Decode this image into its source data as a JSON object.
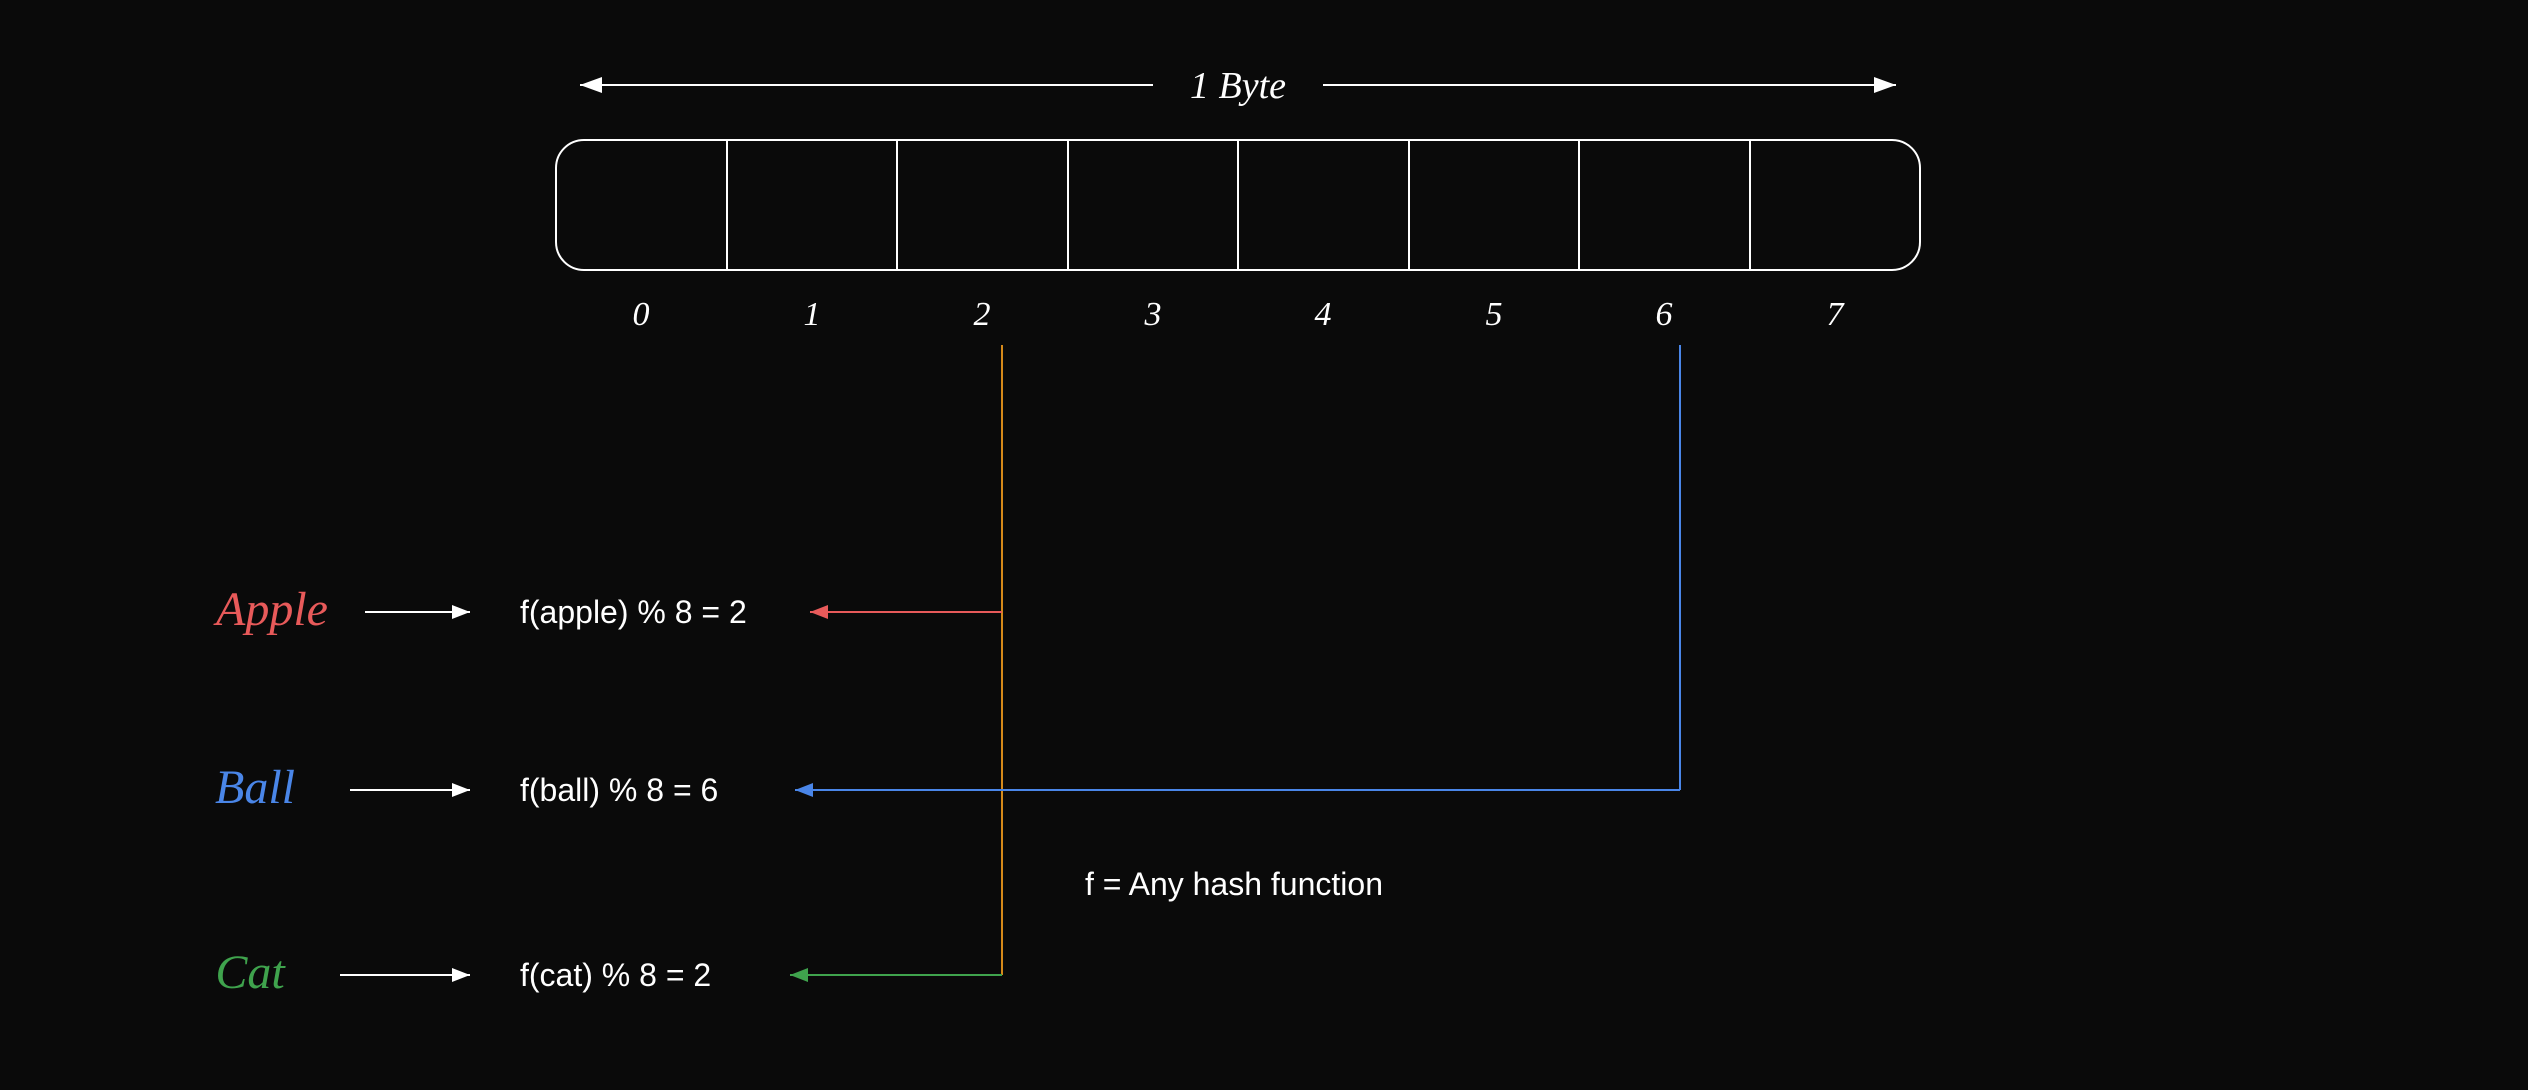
{
  "byte_label": "1 Byte",
  "indices": [
    "0",
    "1",
    "2",
    "3",
    "4",
    "5",
    "6",
    "7"
  ],
  "items": [
    {
      "name": "Apple",
      "expr": "f(apple) % 8 = 2",
      "color": "#e85a5a"
    },
    {
      "name": "Ball",
      "expr": "f(ball) % 8 = 6",
      "color": "#4a86e8"
    },
    {
      "name": "Cat",
      "expr": "f(cat) % 8 = 2",
      "color": "#3fa34d"
    }
  ],
  "note": "f = Any hash function",
  "colors": {
    "stroke": "#ffffff",
    "text": "#ffffff",
    "apple": "#e85a5a",
    "ball": "#4a86e8",
    "cat": "#3fa34d",
    "vert": "#d68a1a"
  }
}
